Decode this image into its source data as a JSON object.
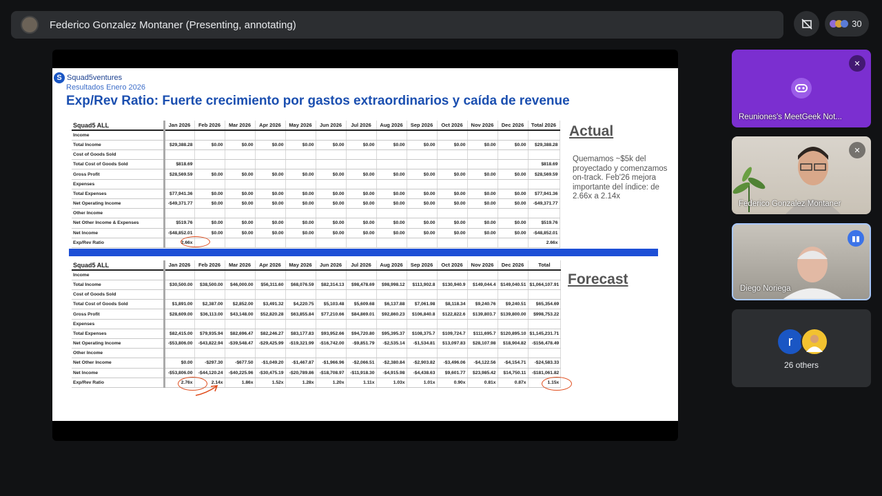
{
  "topbar": {
    "presenter": "Federico Gonzalez Montaner (Presenting, annotating)",
    "participant_count": "30"
  },
  "slide": {
    "logo": "Squad5ventures",
    "subtitle": "Resultados Enero 2026",
    "headline": "Exp/Rev Ratio: Fuerte crecimiento por gastos extraordinarios y caída de revenue",
    "actual_label": "Actual",
    "forecast_label": "Forecast",
    "note": "Quemamos ~$5k del proyectado y comenzamos on-track. Feb'26 mejora importante del índice: de 2.66x a 2.14x",
    "actual_table": {
      "header": [
        "Squad5 ALL",
        "Jan 2026",
        "Feb 2026",
        "Mar 2026",
        "Apr 2026",
        "May 2026",
        "Jun 2026",
        "Jul 2026",
        "Aug 2026",
        "Sep 2026",
        "Oct 2026",
        "Nov 2026",
        "Dec 2026",
        "Total 2026"
      ],
      "rows": [
        [
          "Income",
          "",
          "",
          "",
          "",
          "",
          "",
          "",
          "",
          "",
          "",
          "",
          "",
          ""
        ],
        [
          "Total Income",
          "$29,388.28",
          "$0.00",
          "$0.00",
          "$0.00",
          "$0.00",
          "$0.00",
          "$0.00",
          "$0.00",
          "$0.00",
          "$0.00",
          "$0.00",
          "$0.00",
          "$29,388.28"
        ],
        [
          "Cost of Goods Sold",
          "",
          "",
          "",
          "",
          "",
          "",
          "",
          "",
          "",
          "",
          "",
          "",
          ""
        ],
        [
          "Total Cost of Goods Sold",
          "$818.69",
          "",
          "",
          "",
          "",
          "",
          "",
          "",
          "",
          "",
          "",
          "",
          "$818.69"
        ],
        [
          "Gross Profit",
          "$28,569.59",
          "$0.00",
          "$0.00",
          "$0.00",
          "$0.00",
          "$0.00",
          "$0.00",
          "$0.00",
          "$0.00",
          "$0.00",
          "$0.00",
          "$0.00",
          "$28,569.59"
        ],
        [
          "Expenses",
          "",
          "",
          "",
          "",
          "",
          "",
          "",
          "",
          "",
          "",
          "",
          "",
          ""
        ],
        [
          "Total Expenses",
          "$77,941.36",
          "$0.00",
          "$0.00",
          "$0.00",
          "$0.00",
          "$0.00",
          "$0.00",
          "$0.00",
          "$0.00",
          "$0.00",
          "$0.00",
          "$0.00",
          "$77,941.36"
        ],
        [
          "Net Operating Income",
          "-$49,371.77",
          "$0.00",
          "$0.00",
          "$0.00",
          "$0.00",
          "$0.00",
          "$0.00",
          "$0.00",
          "$0.00",
          "$0.00",
          "$0.00",
          "$0.00",
          "-$49,371.77"
        ],
        [
          "Other Income",
          "",
          "",
          "",
          "",
          "",
          "",
          "",
          "",
          "",
          "",
          "",
          "",
          ""
        ],
        [
          "Net Other Income & Expenses",
          "$519.76",
          "$0.00",
          "$0.00",
          "$0.00",
          "$0.00",
          "$0.00",
          "$0.00",
          "$0.00",
          "$0.00",
          "$0.00",
          "$0.00",
          "$0.00",
          "$519.76"
        ],
        [
          "Net Income",
          "-$48,852.01",
          "$0.00",
          "$0.00",
          "$0.00",
          "$0.00",
          "$0.00",
          "$0.00",
          "$0.00",
          "$0.00",
          "$0.00",
          "$0.00",
          "$0.00",
          "-$48,852.01"
        ],
        [
          "Exp/Rev Ratio",
          "2.66x",
          "",
          "",
          "",
          "",
          "",
          "",
          "",
          "",
          "",
          "",
          "",
          "2.66x"
        ]
      ]
    },
    "forecast_table": {
      "header": [
        "Squad5 ALL",
        "Jan 2026",
        "Feb 2026",
        "Mar 2026",
        "Apr 2026",
        "May 2026",
        "Jun 2026",
        "Jul 2026",
        "Aug 2026",
        "Sep 2026",
        "Oct 2026",
        "Nov 2026",
        "Dec 2026",
        "Total"
      ],
      "rows": [
        [
          "Income",
          "",
          "",
          "",
          "",
          "",
          "",
          "",
          "",
          "",
          "",
          "",
          "",
          ""
        ],
        [
          "Total Income",
          "$30,500.00",
          "$38,500.00",
          "$46,000.00",
          "$56,311.60",
          "$68,076.59",
          "$82,314.13",
          "$98,478.69",
          "$98,998.12",
          "$113,902.8",
          "$130,940.9",
          "$149,044.4",
          "$149,040.51",
          "$1,064,107.91"
        ],
        [
          "Cost of Goods Sold",
          "",
          "",
          "",
          "",
          "",
          "",
          "",
          "",
          "",
          "",
          "",
          "",
          ""
        ],
        [
          "Total Cost of Goods Sold",
          "$1,891.00",
          "$2,387.00",
          "$2,852.00",
          "$3,491.32",
          "$4,220.75",
          "$5,103.48",
          "$5,609.68",
          "$6,137.88",
          "$7,061.98",
          "$8,118.34",
          "$9,240.76",
          "$9,240.51",
          "$65,354.69"
        ],
        [
          "Gross Profit",
          "$28,609.00",
          "$36,113.00",
          "$43,148.00",
          "$52,820.28",
          "$63,855.84",
          "$77,210.66",
          "$84,869.01",
          "$92,860.23",
          "$106,840.8",
          "$122,822.6",
          "$139,803.7",
          "$139,800.00",
          "$998,753.22"
        ],
        [
          "Expenses",
          "",
          "",
          "",
          "",
          "",
          "",
          "",
          "",
          "",
          "",
          "",
          "",
          ""
        ],
        [
          "Total Expenses",
          "$82,415.00",
          "$79,935.94",
          "$82,696.47",
          "$82,246.27",
          "$83,177.83",
          "$93,952.66",
          "$94,720.80",
          "$95,395.37",
          "$108,375.7",
          "$109,724.7",
          "$111,695.7",
          "$120,895.10",
          "$1,145,231.71"
        ],
        [
          "Net Operating Income",
          "-$53,806.00",
          "-$43,822.94",
          "-$39,548.47",
          "-$29,425.99",
          "-$19,321.99",
          "-$16,742.00",
          "-$9,851.79",
          "-$2,535.14",
          "-$1,534.81",
          "$13,097.83",
          "$28,107.98",
          "$18,904.82",
          "-$156,478.49"
        ],
        [
          "Other Income",
          "",
          "",
          "",
          "",
          "",
          "",
          "",
          "",
          "",
          "",
          "",
          "",
          ""
        ],
        [
          "Net Other Income",
          "$0.00",
          "-$297.30",
          "-$677.50",
          "-$1,049.20",
          "-$1,467.87",
          "-$1,966.96",
          "-$2,066.51",
          "-$2,380.84",
          "-$2,903.82",
          "-$3,496.06",
          "-$4,122.56",
          "-$4,154.71",
          "-$24,583.33"
        ],
        [
          "Net Income",
          "-$53,806.00",
          "-$44,120.24",
          "-$40,225.96",
          "-$30,475.19",
          "-$20,789.86",
          "-$18,708.97",
          "-$11,918.30",
          "-$4,915.98",
          "-$4,438.63",
          "$9,601.77",
          "$23,985.42",
          "$14,750.11",
          "-$181,061.82"
        ],
        [
          "Exp/Rev Ratio",
          "2.76x",
          "2.14x",
          "1.86x",
          "1.52x",
          "1.28x",
          "1.20x",
          "1.11x",
          "1.03x",
          "1.01x",
          "0.90x",
          "0.81x",
          "0.87x",
          "1.15x"
        ]
      ]
    }
  },
  "participants": {
    "tile1_name": "Reuniones's MeetGeek Not...",
    "tile2_name": "Federico Gonzalez Montaner",
    "tile3_name": "Diego Noriega",
    "others_initial": "r",
    "others_label": "26 others"
  },
  "colors": {
    "accent_blue": "#1d4fd6",
    "annotation": "#e04b1a",
    "meetgeek_purple": "#7b2fd0"
  }
}
